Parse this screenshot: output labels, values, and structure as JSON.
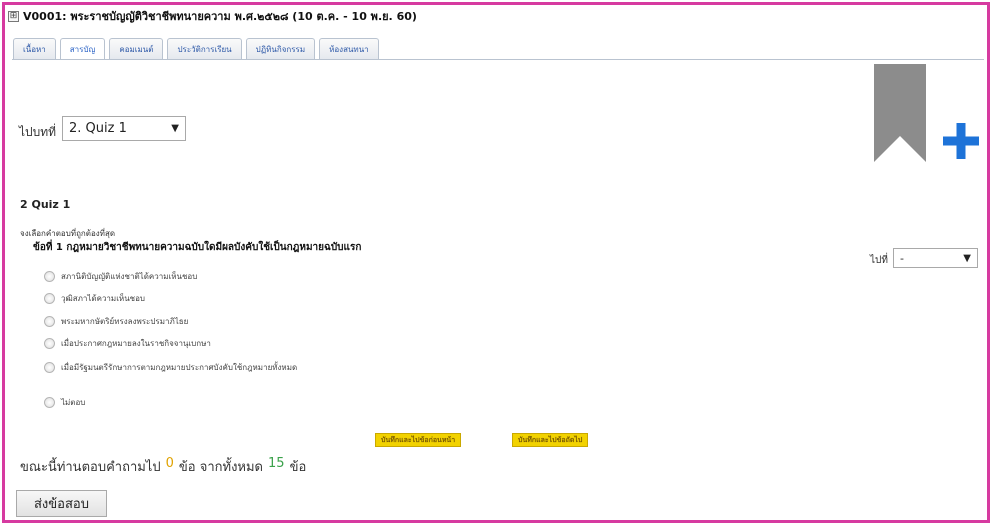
{
  "course": {
    "title": "V0001: พระราชบัญญัติวิชาชีพทนายความ พ.ศ.๒๕๒๘ (10 ต.ค. - 10 พ.ย. 60)",
    "expand_symbol": "⊞"
  },
  "tabs": [
    "เนื้อหา",
    "สารบัญ",
    "คอมเมนต์",
    "ประวัติการเรียน",
    "ปฏิทินกิจกรรม",
    "ห้องสนทนา"
  ],
  "navigation": {
    "goto_label": "ไปบทที่",
    "goto_value": "2. Quiz 1",
    "question_goto_label": "ไปที่",
    "question_goto_value": "-"
  },
  "quiz": {
    "heading": "2 Quiz 1",
    "instruction": "จงเลือกคำตอบที่ถูกต้องที่สุด",
    "question": "ข้อที่ 1 กฎหมายวิชาชีพทนายความฉบับใดมีผลบังคับใช้เป็นกฎหมายฉบับแรก",
    "choices": [
      "สภานิติบัญญัติแห่งชาติได้ความเห็นชอบ",
      "วุฒิสภาได้ความเห็นชอบ",
      "พระมหากษัตริย์ทรงลงพระปรมาภิไธย",
      "เมื่อประกาศกฎหมายลงในราชกิจจานุเบกษา",
      "เมื่อมีรัฐมนตรีรักษาการตามกฎหมายประกาศบังคับใช้กฎหมายทั้งหมด",
      "ไม่ตอบ"
    ]
  },
  "actions": {
    "save_previous": "บันทึกและไปข้อก่อนหน้า",
    "save_next": "บันทึกและไปข้อถัดไป",
    "submit": "ส่งข้อสอบ"
  },
  "progress": {
    "prefix": "ขณะนี้ท่านตอบคำถามไป",
    "answered": "0",
    "middle": "ข้อ จากทั้งหมด",
    "total": "15",
    "suffix": "ข้อ"
  },
  "colors": {
    "frame": "#d63aa0",
    "bookmark": "#8c8c8c",
    "plus": "#1e73d8",
    "button_yellow": "#f2d200",
    "answered": "#e0a200",
    "total": "#3aa14a"
  }
}
